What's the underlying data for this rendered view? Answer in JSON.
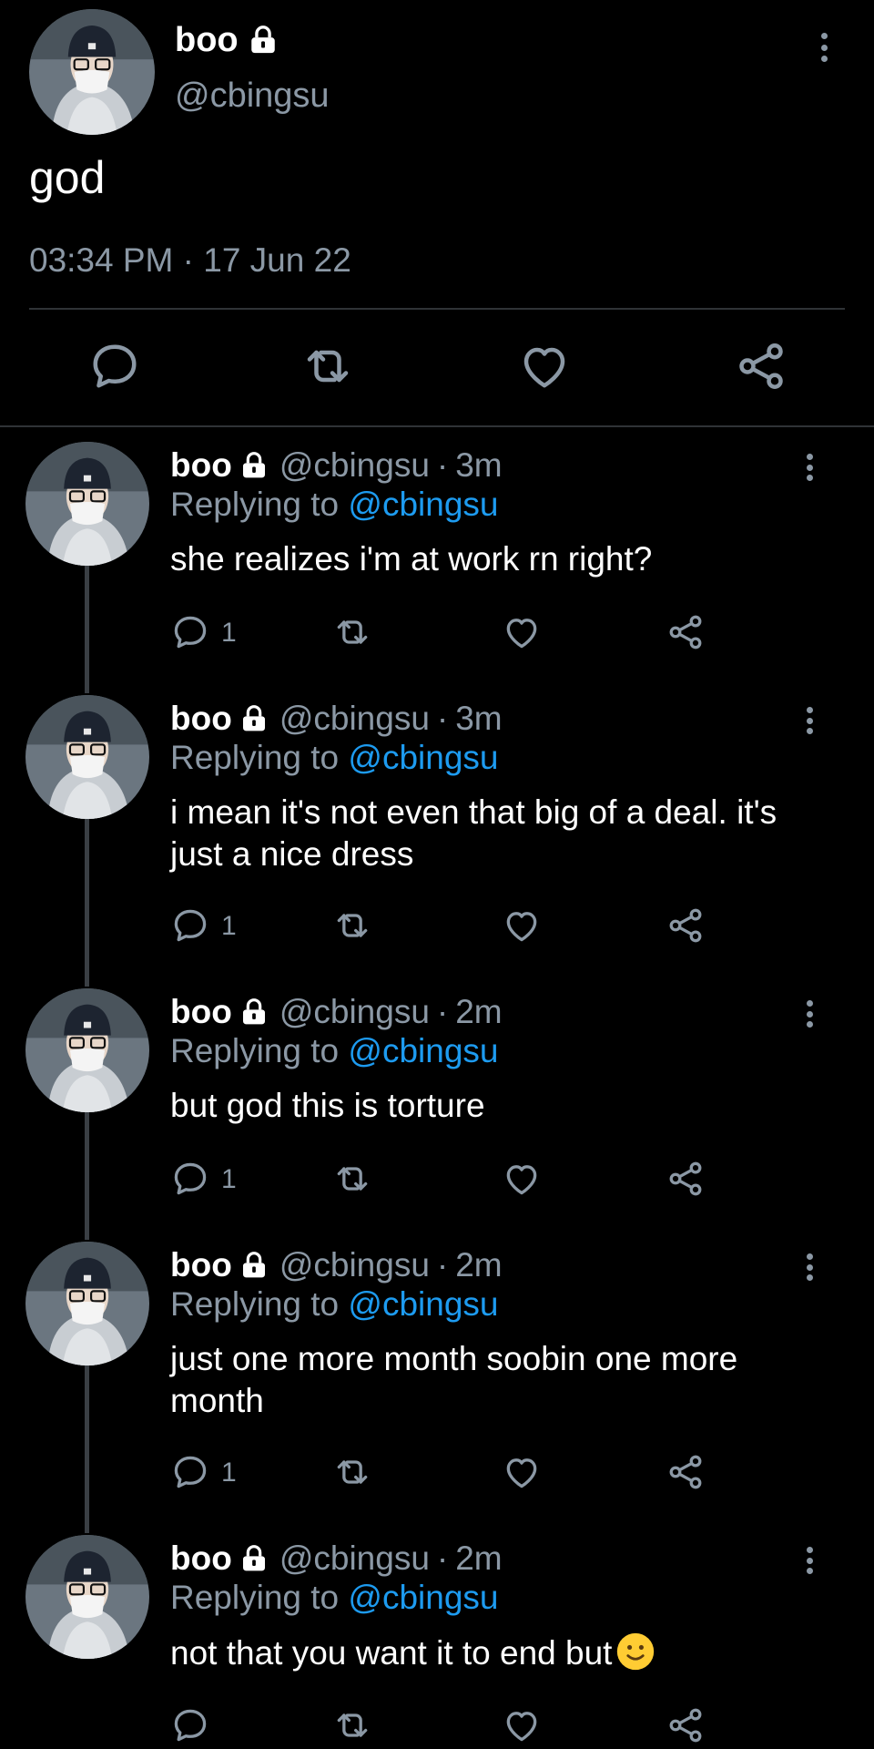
{
  "main_tweet": {
    "author_name": "boo",
    "author_handle": "@cbingsu",
    "text": "god",
    "timestamp": "03:34 PM · 17 Jun 22",
    "icons": {
      "lock": "lock-icon",
      "more": "more-vertical-icon",
      "reply": "comment-icon",
      "retweet": "retweet-icon",
      "like": "heart-icon",
      "share": "share-icon"
    }
  },
  "replies": [
    {
      "name": "boo",
      "handle": "@cbingsu",
      "sep": "·",
      "time": "3m",
      "replying_prefix": "Replying to",
      "replying_to": "@cbingsu",
      "text": "she realizes i'm at work rn right?",
      "reply_count": "1"
    },
    {
      "name": "boo",
      "handle": "@cbingsu",
      "sep": "·",
      "time": "3m",
      "replying_prefix": "Replying to",
      "replying_to": "@cbingsu",
      "text": "i mean it's not even that big of a deal. it's just a nice dress",
      "reply_count": "1"
    },
    {
      "name": "boo",
      "handle": "@cbingsu",
      "sep": "·",
      "time": "2m",
      "replying_prefix": "Replying to",
      "replying_to": "@cbingsu",
      "text": "but god this is torture",
      "reply_count": "1"
    },
    {
      "name": "boo",
      "handle": "@cbingsu",
      "sep": "·",
      "time": "2m",
      "replying_prefix": "Replying to",
      "replying_to": "@cbingsu",
      "text": "just one more month soobin one more month",
      "reply_count": "1"
    },
    {
      "name": "boo",
      "handle": "@cbingsu",
      "sep": "·",
      "time": "2m",
      "replying_prefix": "Replying to",
      "replying_to": "@cbingsu",
      "text": "not that you want it to end but",
      "emoji": "slightly-smiling-face-emoji",
      "reply_count": ""
    }
  ],
  "colors": {
    "background": "#000000",
    "primary_text": "#ffffff",
    "secondary_text": "#8b98a5",
    "link": "#1d9bf0",
    "divider": "#2f3336"
  }
}
